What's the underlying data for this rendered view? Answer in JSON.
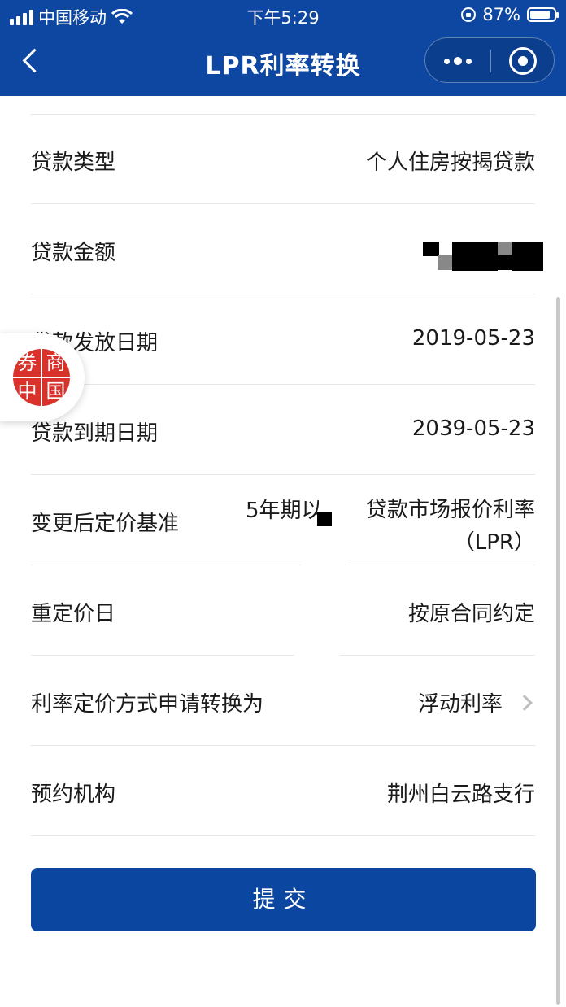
{
  "status_bar": {
    "carrier": "中国移动",
    "time": "下午5:29",
    "battery": "87%",
    "battery_level": 0.87
  },
  "nav": {
    "title": "LPR利率转换",
    "back_icon": "chevron-left-icon",
    "more_icon": "more-dots-icon",
    "close_icon": "target-icon"
  },
  "form": {
    "rows": [
      {
        "label": "贷款类型",
        "value": "个人住房按揭贷款"
      },
      {
        "label": "贷款金额",
        "value": ""
      },
      {
        "label": "贷款发放日期",
        "value": "2019-05-23"
      },
      {
        "label": "贷款到期日期",
        "value": "2039-05-23"
      },
      {
        "label": "变更后定价基准",
        "value_prefix": "5年期以",
        "value_line1": "贷款市场报价利率",
        "value_line2": "（LPR）"
      },
      {
        "label": "重定价日",
        "value": "按原合同约定"
      },
      {
        "label": "利率定价方式申请转换为",
        "value": "浮动利率"
      },
      {
        "label": "预约机构",
        "value": "荆州白云路支行"
      }
    ]
  },
  "floating_logo": {
    "chars": [
      "券",
      "商",
      "中",
      "国"
    ],
    "color": "#d8322a"
  },
  "submit": {
    "label": "提交"
  },
  "colors": {
    "brand": "#0d47a1",
    "button": "#0b46a0",
    "divider": "#e6e6e6"
  }
}
